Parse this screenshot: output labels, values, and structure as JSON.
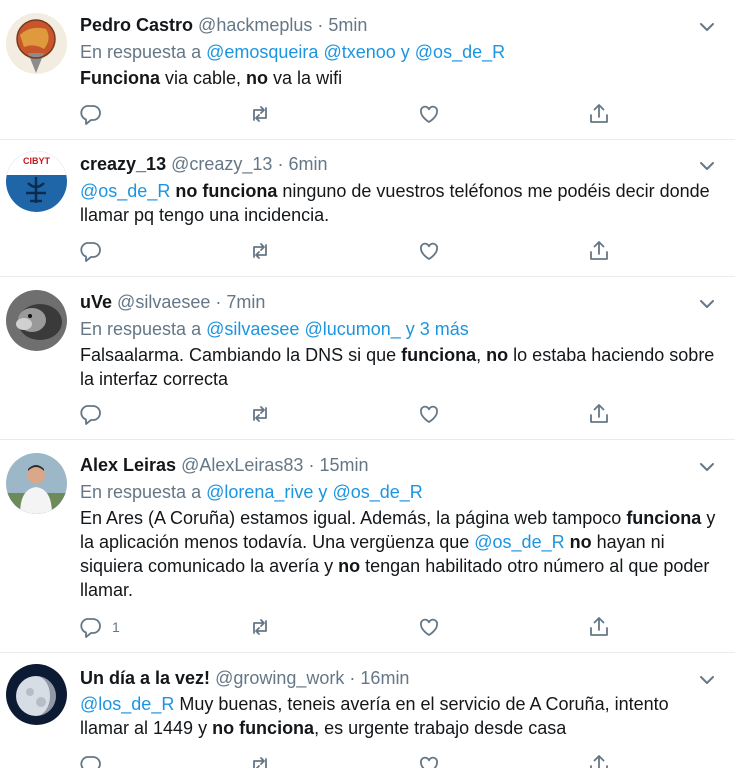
{
  "tweets": [
    {
      "name": "Pedro Castro",
      "handle": "@hackmeplus",
      "time": "5min",
      "reply_prefix": "En respuesta a ",
      "reply_mentions": [
        "@emosqueira",
        "@txenoo"
      ],
      "reply_joiner": " y ",
      "reply_last": "@os_de_R",
      "segments": [
        {
          "t": "Funciona",
          "s": "b"
        },
        {
          "t": " via cable, ",
          "s": ""
        },
        {
          "t": "no",
          "s": "b"
        },
        {
          "t": " va la wifi",
          "s": ""
        }
      ],
      "reply_count": ""
    },
    {
      "name": "creazy_13",
      "handle": "@creazy_13",
      "time": "6min",
      "avatar_text": "CIBYT",
      "segments": [
        {
          "t": "@os_de_R",
          "s": "m"
        },
        {
          "t": " ",
          "s": ""
        },
        {
          "t": "no funciona",
          "s": "b"
        },
        {
          "t": " ninguno de vuestros teléfonos me podéis decir donde llamar pq tengo una incidencia.",
          "s": ""
        }
      ],
      "reply_count": ""
    },
    {
      "name": "uVe",
      "handle": "@silvaesee",
      "time": "7min",
      "reply_prefix": "En respuesta a ",
      "reply_mentions": [
        "@silvaesee",
        "@lucumon_"
      ],
      "reply_joiner": " y ",
      "reply_last": "3 más",
      "segments": [
        {
          "t": "Falsaalarma. Cambiando la DNS si que ",
          "s": ""
        },
        {
          "t": "funciona",
          "s": "b"
        },
        {
          "t": ", ",
          "s": ""
        },
        {
          "t": "no",
          "s": "b"
        },
        {
          "t": " lo estaba haciendo sobre la interfaz correcta",
          "s": ""
        }
      ],
      "reply_count": ""
    },
    {
      "name": "Alex Leiras",
      "handle": "@AlexLeiras83",
      "time": "15min",
      "reply_prefix": "En respuesta a ",
      "reply_mentions": [
        "@lorena_rive"
      ],
      "reply_joiner": " y ",
      "reply_last": "@os_de_R",
      "segments": [
        {
          "t": "En Ares (A Coruña) estamos igual. Además, la página web tampoco ",
          "s": ""
        },
        {
          "t": "funciona",
          "s": "b"
        },
        {
          "t": " y la aplicación menos todavía. Una vergüenza que ",
          "s": ""
        },
        {
          "t": "@os_de_R",
          "s": "m"
        },
        {
          "t": " ",
          "s": ""
        },
        {
          "t": "no",
          "s": "b"
        },
        {
          "t": " hayan ni siquiera comunicado la avería y ",
          "s": ""
        },
        {
          "t": "no",
          "s": "b"
        },
        {
          "t": " tengan habilitado otro número al que poder llamar.",
          "s": ""
        }
      ],
      "reply_count": "1"
    },
    {
      "name": "Un día a la vez!",
      "handle": "@growing_work",
      "time": "16min",
      "segments": [
        {
          "t": "@los_de_R",
          "s": "m"
        },
        {
          "t": " Muy buenas, teneis avería en el servicio de A Coruña, intento llamar al 1449 y ",
          "s": ""
        },
        {
          "t": "no funciona",
          "s": "b"
        },
        {
          "t": ", es urgente trabajo desde casa",
          "s": ""
        }
      ],
      "reply_count": ""
    }
  ],
  "separator": "·",
  "colors": {
    "text": "#14171a",
    "muted": "#657786",
    "link": "#1b95e0",
    "border": "#e6ecf0"
  },
  "icons": [
    "chevron-down-icon",
    "reply-icon",
    "retweet-icon",
    "like-icon",
    "share-icon"
  ]
}
